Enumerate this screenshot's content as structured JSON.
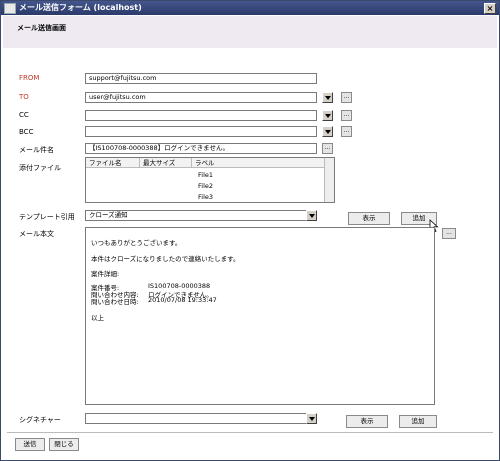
{
  "window": {
    "title": "メール送信フォーム (localhost)",
    "close": "×"
  },
  "page_title": "メール送信画面",
  "from": {
    "label": "FROM",
    "value": "support@fujitsu.com"
  },
  "to": {
    "label": "TO",
    "value": "user@fujitsu.com",
    "more": "..."
  },
  "cc": {
    "label": "CC",
    "value": "",
    "more": "..."
  },
  "bcc": {
    "label": "BCC",
    "value": "",
    "more": "..."
  },
  "subject": {
    "label": "メール件名",
    "value": "【IS100708-0000388】ログインできません。",
    "more": "..."
  },
  "attachments": {
    "label": "添付ファイル",
    "columns": [
      "ファイル名",
      "最大サイズ",
      "ラベル"
    ],
    "files": [
      "File1",
      "File2",
      "File3"
    ]
  },
  "template": {
    "label": "テンプレート引用",
    "value": "クローズ通知",
    "show_label": "表示",
    "add_label": "追加"
  },
  "body": {
    "label": "メール本文",
    "more": "...",
    "line1": "いつもありがとうございます。",
    "line2": "本件はクローズになりましたので連絡いたします。",
    "line3": "案件詳細:",
    "k1": "案件番号:",
    "v1": "IS100708-0000388",
    "k2": "問い合わせ内容:",
    "v2": "ログインできません。",
    "k3": "問い合わせ日時:",
    "v3": "2010/07/08 19:33:47",
    "line4": "以上"
  },
  "signature": {
    "label": "シグネチャー",
    "value": "",
    "show_label": "表示",
    "add_label": "追加"
  },
  "footer": {
    "send_label": "送信",
    "close_label": "閉じる"
  }
}
